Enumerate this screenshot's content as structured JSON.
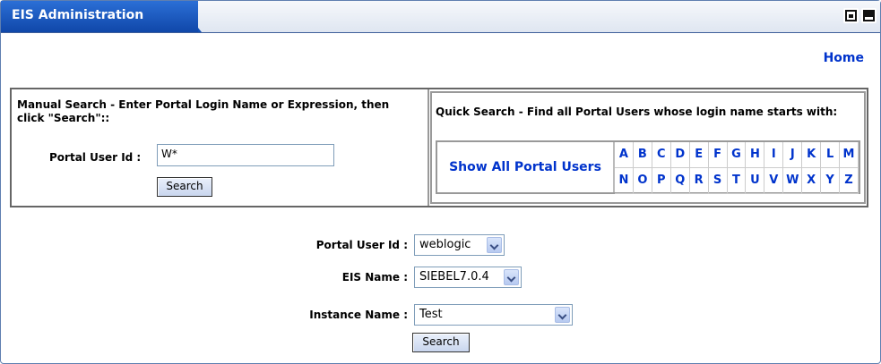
{
  "window": {
    "title": "EIS Administration"
  },
  "nav": {
    "home_label": "Home"
  },
  "manual_search": {
    "heading": "Manual Search - Enter Portal Login Name or Expression, then click \"Search\"::",
    "portal_user_label": "Portal User Id :",
    "portal_user_value": "W*",
    "search_button": "Search"
  },
  "quick_search": {
    "heading": "Quick Search - Find all Portal Users whose login name starts with:",
    "show_all_label": "Show All Portal Users",
    "letters": [
      "A",
      "B",
      "C",
      "D",
      "E",
      "F",
      "G",
      "H",
      "I",
      "J",
      "K",
      "L",
      "M",
      "N",
      "O",
      "P",
      "Q",
      "R",
      "S",
      "T",
      "U",
      "V",
      "W",
      "X",
      "Y",
      "Z"
    ]
  },
  "form": {
    "portal_user_label": "Portal User Id :",
    "portal_user_value": "weblogic",
    "eis_name_label": "EIS Name :",
    "eis_name_value": "SIEBEL7.0.4",
    "instance_label": "Instance Name :",
    "instance_value": "Test",
    "search_button": "Search"
  }
}
